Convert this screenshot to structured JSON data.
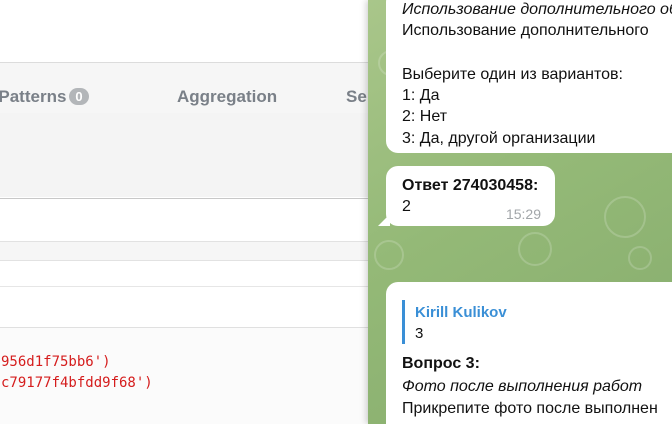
{
  "left_panel": {
    "tabs": [
      {
        "label": "i-Patterns",
        "badge": "0"
      },
      {
        "label": "Aggregation"
      },
      {
        "label": "Se"
      }
    ],
    "code_lines": [
      "956d1f75bb6')",
      "c79177f4bfdd9f68')"
    ]
  },
  "chat": {
    "message1": {
      "title_italic": "Использование дополнительного об",
      "title": "Использование дополнительного",
      "prompt": "Выберите один из вариантов:",
      "options": [
        "1: Да",
        "2: Нет",
        "3: Да, другой организации"
      ]
    },
    "message2": {
      "header": "Ответ 274030458:",
      "value": "2",
      "time": "15:29"
    },
    "message3": {
      "reply_name": "Kirill Kulikov",
      "reply_text": "3",
      "header": "Вопрос 3:",
      "subtitle": "Фото после выполнения работ",
      "body": "Прикрепите фото после выполнен"
    }
  },
  "colors": {
    "chat_bg": "#94b977",
    "link_blue": "#3a8fd6",
    "code_red": "#d51d1d"
  }
}
